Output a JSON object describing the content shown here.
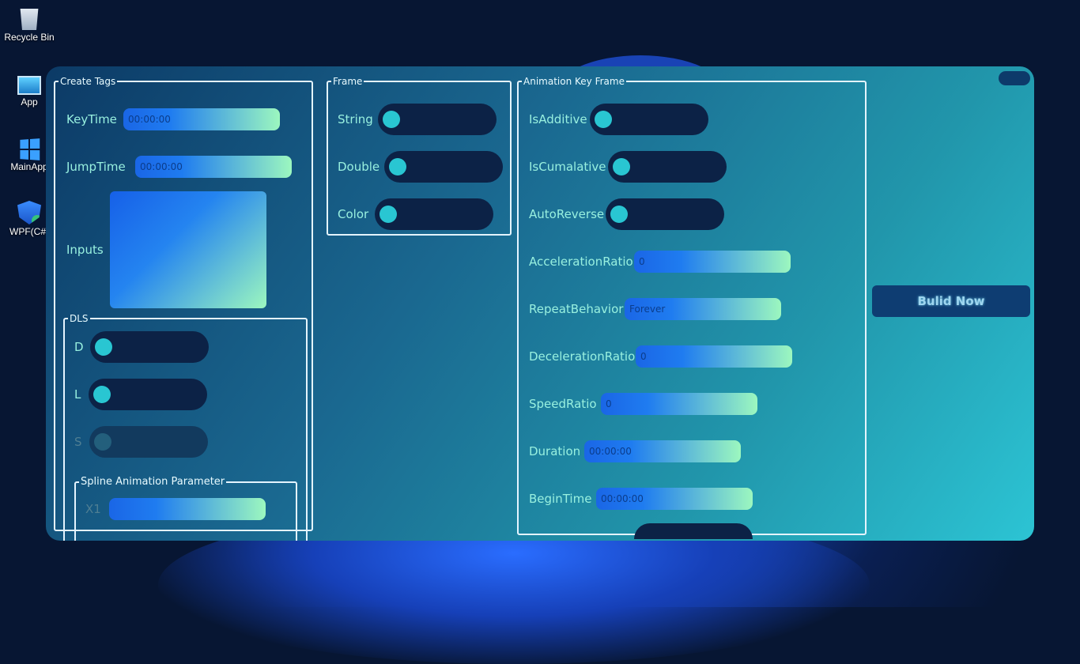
{
  "desktop": {
    "icons": [
      {
        "label": "Recycle Bin",
        "icon": "recycle-bin-icon"
      },
      {
        "label": "App",
        "icon": "monitor-icon"
      },
      {
        "label": "MainApp",
        "icon": "windows-icon"
      },
      {
        "label": "WPF(C#)",
        "icon": "shield-icon"
      }
    ]
  },
  "create_tags": {
    "legend": "Create Tags",
    "keytime": {
      "label": "KeyTime",
      "value": "00:00:00"
    },
    "jumptime": {
      "label": "JumpTime",
      "value": "00:00:00"
    },
    "inputs_label": "Inputs",
    "dls": {
      "legend": "DLS",
      "d_label": "D",
      "l_label": "L",
      "s_label": "S"
    },
    "spline": {
      "legend": "Spline Animation Parameter",
      "x1_label": "X1"
    }
  },
  "frame": {
    "legend": "Frame",
    "string_label": "String",
    "double_label": "Double",
    "color_label": "Color"
  },
  "animation": {
    "legend": "Animation Key Frame",
    "is_additive": "IsAdditive",
    "is_cumulative": "IsCumalative",
    "auto_reverse": "AutoReverse",
    "acceleration": {
      "label": "AccelerationRatio",
      "value": "0"
    },
    "repeat": {
      "label": "RepeatBehavior",
      "value": "Forever"
    },
    "deceleration": {
      "label": "DecelerationRatio",
      "value": "0"
    },
    "speed": {
      "label": "SpeedRatio",
      "value": "0"
    },
    "duration": {
      "label": "Duration",
      "value": "00:00:00"
    },
    "begin_time": {
      "label": "BeginTime",
      "value": "00:00:00"
    }
  },
  "build_button": "Bulid Now",
  "colors": {
    "window_start": "#0c3a66",
    "window_end": "#2cc4d4",
    "toggle_track": "#0c2246",
    "toggle_knob": "#29c6d2",
    "label_text": "#98f0df",
    "field_gradient_start": "#1a66e6",
    "field_gradient_end": "#9cf7bf"
  }
}
